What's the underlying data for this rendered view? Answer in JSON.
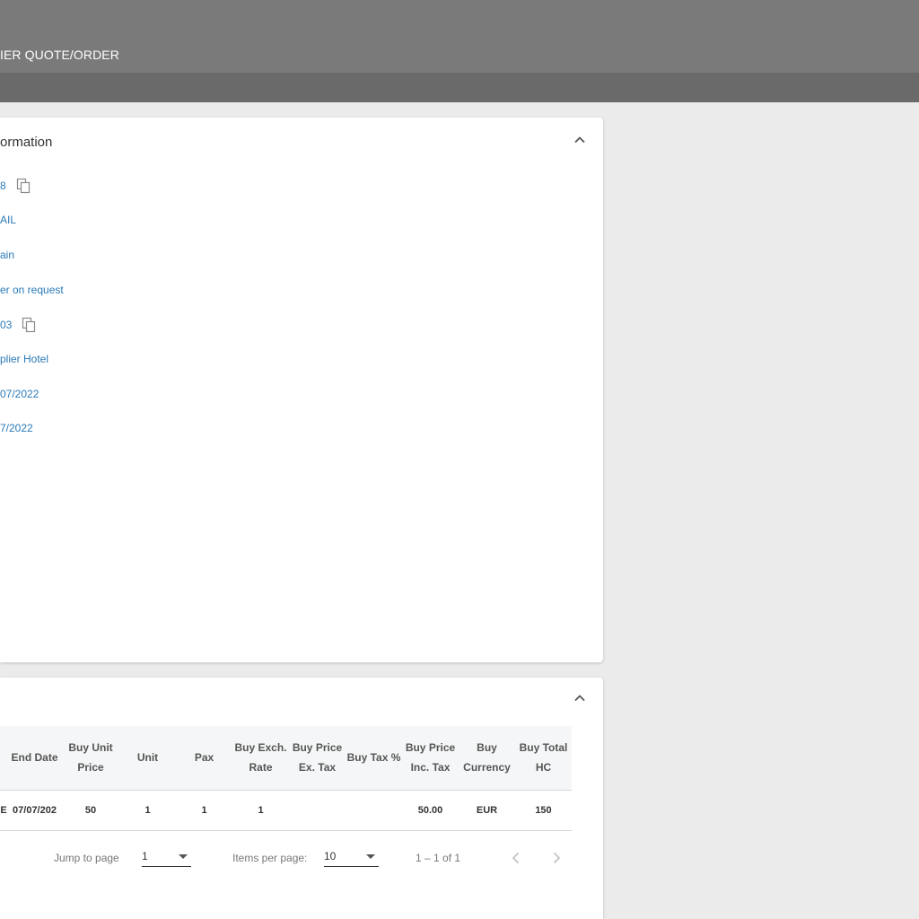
{
  "header": {
    "title": "IER QUOTE/ORDER"
  },
  "info_card": {
    "title": "ormation",
    "fields": [
      {
        "value": "8",
        "copyable": true
      },
      {
        "value": "AIL",
        "copyable": false
      },
      {
        "value": "ain",
        "copyable": false
      },
      {
        "value": "er on request",
        "copyable": false
      },
      {
        "value": "03",
        "copyable": true
      },
      {
        "value": "plier Hotel",
        "copyable": false
      },
      {
        "value": "07/2022",
        "copyable": false
      },
      {
        "value": "7/2022",
        "copyable": false
      }
    ]
  },
  "lines_card": {
    "columns": [
      "End Date",
      "Buy Unit Price",
      "Unit",
      "Pax",
      "Buy Exch. Rate",
      "Buy Price Ex. Tax",
      "Buy Tax %",
      "Buy Price Inc. Tax",
      "Buy Currency",
      "Buy Total HC"
    ],
    "rows": [
      {
        "lead": "E",
        "cells": [
          "07/07/202",
          "50",
          "1",
          "1",
          "1",
          "",
          "",
          "50.00",
          "EUR",
          "150"
        ]
      }
    ],
    "pagination": {
      "jump_label": "Jump to page",
      "jump_value": "1",
      "items_label": "Items per page:",
      "items_value": "10",
      "range": "1 – 1 of 1"
    }
  },
  "colors": {
    "topbar": "#7a7a7a",
    "subbar": "#6a6a6a",
    "link": "#2a7ab8",
    "background": "#ebebeb"
  },
  "icons": [
    "chevron-up-icon",
    "copy-icon",
    "dropdown-caret-icon",
    "chevron-left-icon",
    "chevron-right-icon"
  ]
}
